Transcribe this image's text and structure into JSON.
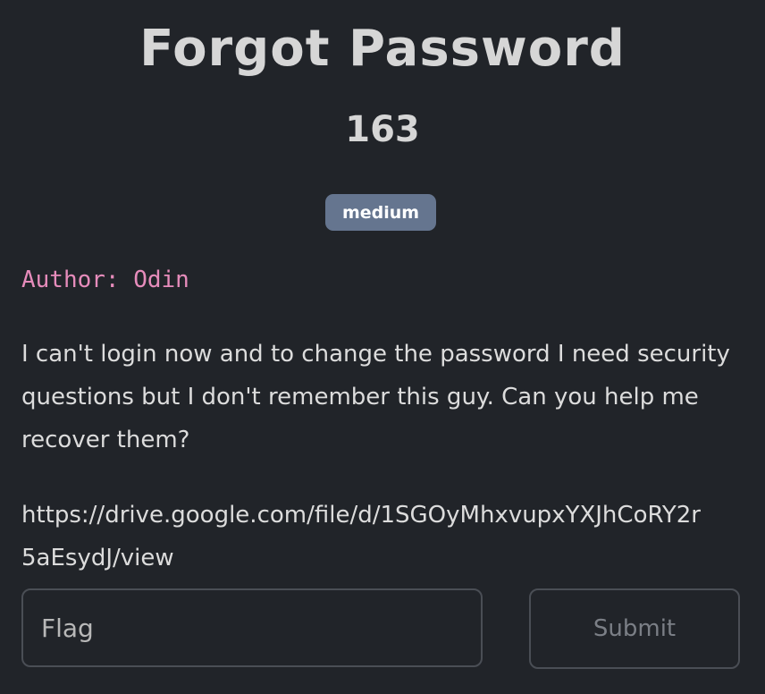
{
  "challenge": {
    "title": "Forgot Password",
    "points": "163",
    "difficulty": "medium",
    "author": "Author: Odin",
    "description": "I can't login now and to change the password I need security questions but I don't remember this guy. Can you help me recover them?",
    "url_line1": "https://drive.google.com/file/d/1SGOyMhxvupxYXJhCoRY2r",
    "url_line2": "5aEsydJ/view"
  },
  "form": {
    "flag_placeholder": "Flag",
    "submit_label": "Submit"
  },
  "colors": {
    "background": "#212429",
    "badge": "#65758f",
    "author": "#e68cbb"
  }
}
